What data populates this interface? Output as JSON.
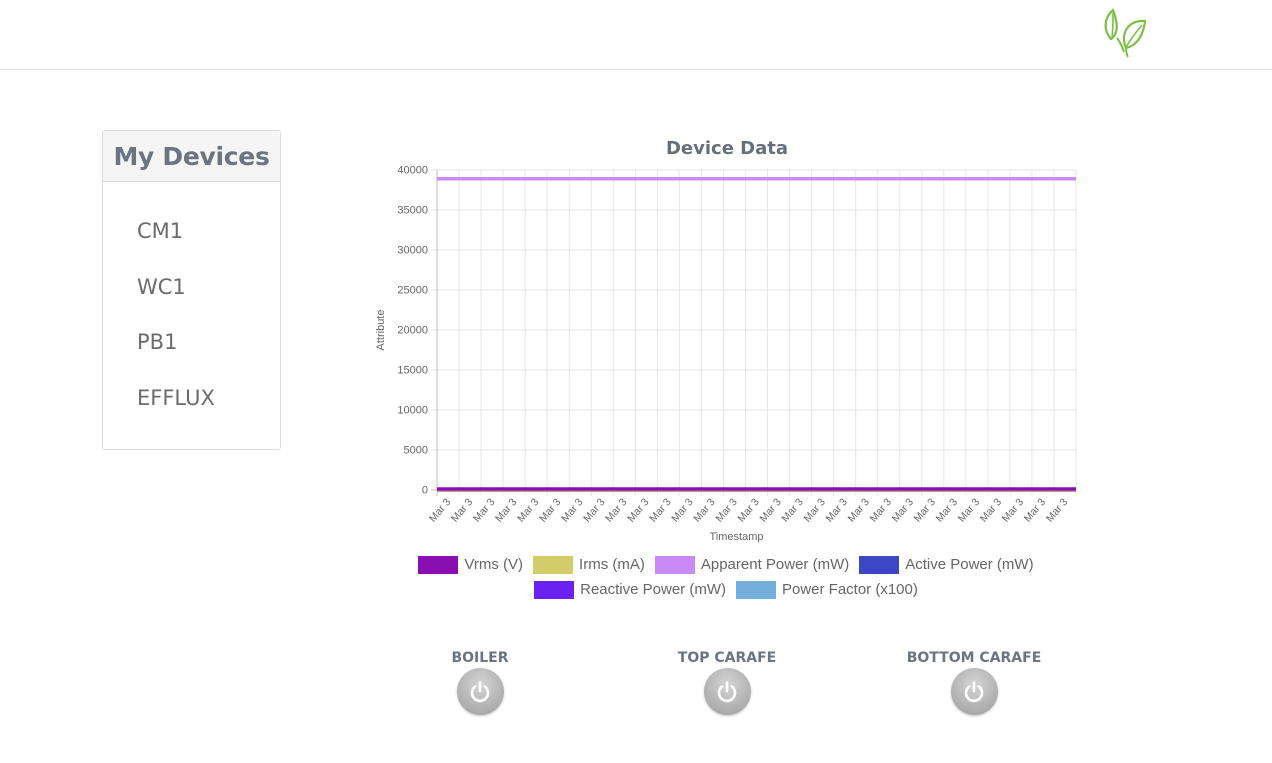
{
  "header": {
    "logo_icon": "leaf-logo-icon"
  },
  "sidebar": {
    "title": "My Devices",
    "items": [
      {
        "label": "CM1"
      },
      {
        "label": "WC1"
      },
      {
        "label": "PB1"
      },
      {
        "label": "EFFLUX"
      }
    ]
  },
  "chart_data": {
    "type": "line",
    "title": "Device Data",
    "xlabel": "Timestamp",
    "ylabel": "Attribute",
    "categories": [
      "Mar 3",
      "Mar 3",
      "Mar 3",
      "Mar 3",
      "Mar 3",
      "Mar 3",
      "Mar 3",
      "Mar 3",
      "Mar 3",
      "Mar 3",
      "Mar 3",
      "Mar 3",
      "Mar 3",
      "Mar 3",
      "Mar 3",
      "Mar 3",
      "Mar 3",
      "Mar 3",
      "Mar 3",
      "Mar 3",
      "Mar 3",
      "Mar 3",
      "Mar 3",
      "Mar 3",
      "Mar 3",
      "Mar 3",
      "Mar 3",
      "Mar 3",
      "Mar 3"
    ],
    "ylim": [
      0,
      40000
    ],
    "yticks": [
      0,
      5000,
      10000,
      15000,
      20000,
      25000,
      30000,
      35000,
      40000
    ],
    "grid": true,
    "legend_position": "bottom",
    "series": [
      {
        "name": "Vrms (V)",
        "color": "#8a0fb0",
        "value": 120
      },
      {
        "name": "Irms (mA)",
        "color": "#d2cc6a",
        "value": 10
      },
      {
        "name": "Apparent Power (mW)",
        "color": "#c98af7",
        "value": 38900
      },
      {
        "name": "Active Power (mW)",
        "color": "#3d47c4",
        "value": 5
      },
      {
        "name": "Reactive Power (mW)",
        "color": "#6a22f0",
        "value": 5
      },
      {
        "name": "Power Factor (x100)",
        "color": "#74aedb",
        "value": 0
      }
    ]
  },
  "controls": [
    {
      "label": "BOILER"
    },
    {
      "label": "TOP CARAFE"
    },
    {
      "label": "BOTTOM CARAFE"
    }
  ]
}
